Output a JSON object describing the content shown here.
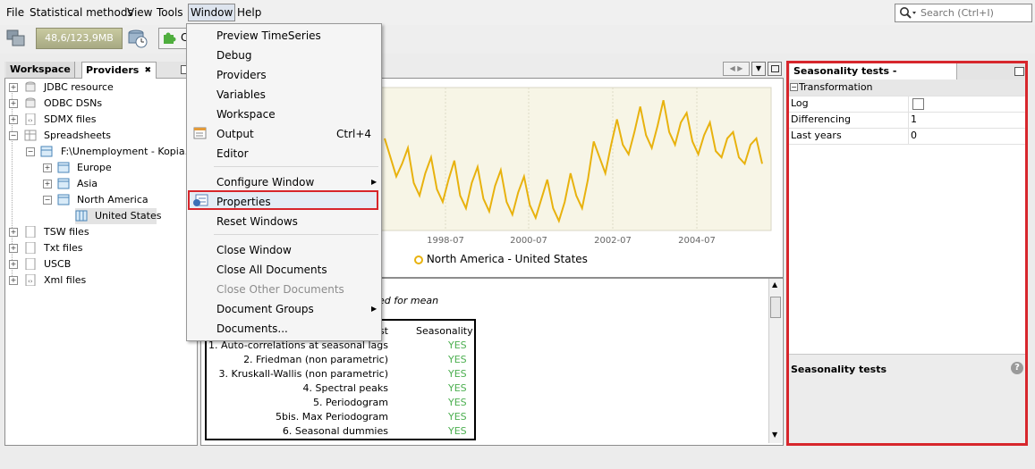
{
  "menubar": {
    "items": [
      "File",
      "Statistical methods",
      "View",
      "Tools",
      "Window",
      "Help"
    ],
    "search_placeholder": "Search (Ctrl+I)"
  },
  "toolbar": {
    "memory": "48,6/123,9MB",
    "partial_button": "C"
  },
  "left_panel": {
    "tabs": [
      "Workspace",
      "Providers"
    ],
    "tree": {
      "jdbc": "JDBC resource",
      "odbc": "ODBC DSNs",
      "sdmx": "SDMX files",
      "spreadsheets": "Spreadsheets",
      "file": "F:\\Unemployment - Kopia.xlsx",
      "europe": "Europe",
      "asia": "Asia",
      "north_america": "North America",
      "united_states": "United States",
      "tsw": "TSW files",
      "txt": "Txt files",
      "uscb": "USCB",
      "xml": "Xml files"
    }
  },
  "window_menu": {
    "preview": "Preview TimeSeries",
    "debug": "Debug",
    "providers": "Providers",
    "variables": "Variables",
    "workspace": "Workspace",
    "output": "Output",
    "output_shortcut": "Ctrl+4",
    "editor": "Editor",
    "configure": "Configure Window",
    "properties": "Properties",
    "reset": "Reset Windows",
    "close_window": "Close Window",
    "close_all": "Close All Documents",
    "close_other": "Close Other Documents",
    "document_groups": "Document Groups",
    "documents": "Documents..."
  },
  "chart_data": {
    "type": "line",
    "x_tick_labels": [
      "1998-07",
      "2000-07",
      "2002-07",
      "2004-07"
    ],
    "legend": "North America - United States",
    "series": [
      {
        "name": "North America - United States",
        "color": "#e8b20e",
        "values": [
          6.4,
          5.8,
          5.2,
          5.6,
          6.1,
          5.0,
          4.6,
          5.3,
          5.8,
          4.8,
          4.4,
          5.1,
          5.7,
          4.6,
          4.2,
          5.0,
          5.5,
          4.5,
          4.1,
          4.9,
          5.4,
          4.4,
          4.0,
          4.7,
          5.2,
          4.3,
          3.9,
          4.5,
          5.1,
          4.2,
          3.8,
          4.4,
          5.3,
          4.6,
          4.2,
          5.1,
          6.3,
          5.8,
          5.3,
          6.2,
          7.0,
          6.2,
          5.9,
          6.6,
          7.4,
          6.5,
          6.1,
          6.8,
          7.6,
          6.6,
          6.2,
          6.9,
          7.2,
          6.3,
          5.9,
          6.5,
          6.9,
          6.0,
          5.8,
          6.4,
          6.6,
          5.8,
          5.6,
          6.2,
          6.4,
          5.6
        ]
      }
    ]
  },
  "text_panel": {
    "note_suffix": "ed for mean",
    "table_header_test": "st",
    "table_header_seasonality": "Seasonality",
    "rows": [
      {
        "test": "1. Auto-correlations at seasonal lags",
        "value": "YES"
      },
      {
        "test": "2. Friedman (non parametric)",
        "value": "YES"
      },
      {
        "test": "3. Kruskall-Wallis (non parametric)",
        "value": "YES"
      },
      {
        "test": "4. Spectral peaks",
        "value": "YES"
      },
      {
        "test": "5. Periodogram",
        "value": "YES"
      },
      {
        "test": "5bis. Max Periodogram",
        "value": "YES"
      },
      {
        "test": "6. Seasonal dummies",
        "value": "YES"
      }
    ]
  },
  "properties_panel": {
    "title": "Seasonality tests - Properties",
    "section": "Transformation",
    "log_label": "Log",
    "differencing_label": "Differencing",
    "differencing_value": "1",
    "last_years_label": "Last years",
    "last_years_value": "0",
    "description_title": "Seasonality tests"
  }
}
